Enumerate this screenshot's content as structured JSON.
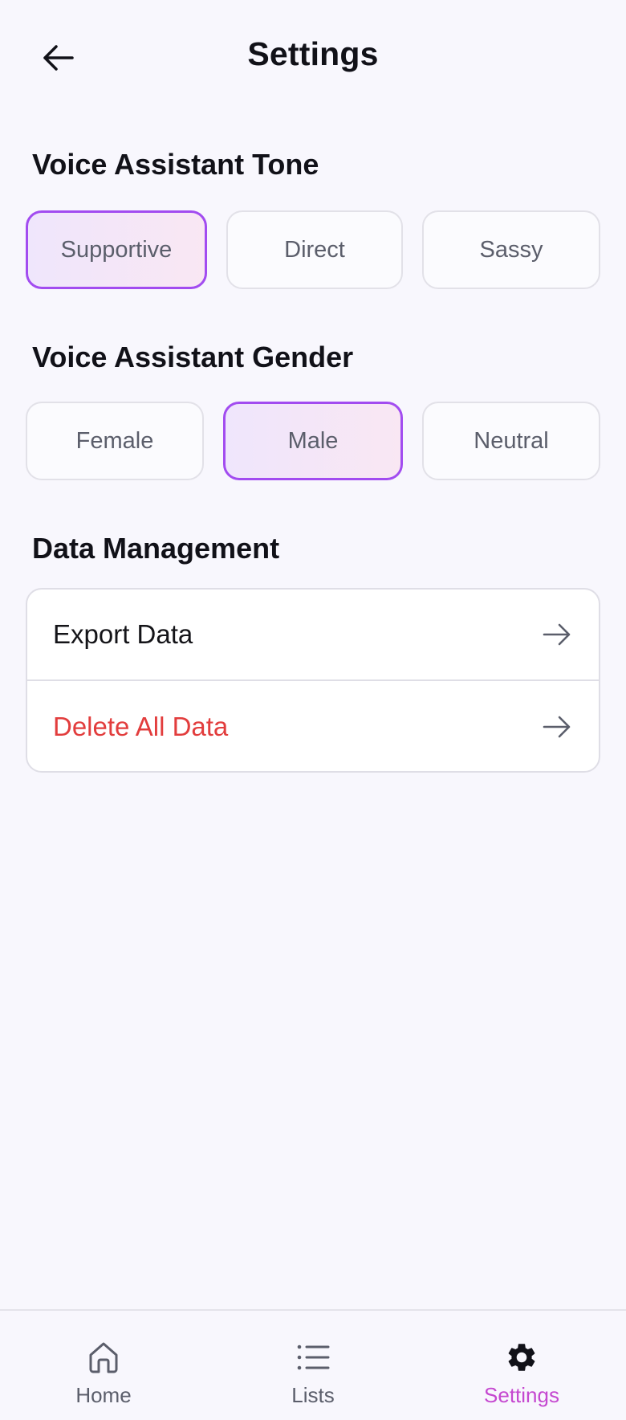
{
  "header": {
    "title": "Settings",
    "back_icon": "arrow-left-icon"
  },
  "tone": {
    "title": "Voice Assistant Tone",
    "options": [
      "Supportive",
      "Direct",
      "Sassy"
    ],
    "selected": "Supportive"
  },
  "gender": {
    "title": "Voice Assistant Gender",
    "options": [
      "Female",
      "Male",
      "Neutral"
    ],
    "selected": "Male"
  },
  "data_management": {
    "title": "Data Management",
    "items": [
      {
        "label": "Export Data",
        "icon": "arrow-right-icon"
      },
      {
        "label": "Delete All Data",
        "icon": "arrow-right-icon",
        "danger": true
      }
    ]
  },
  "bottom_nav": {
    "items": [
      {
        "label": "Home",
        "icon": "home-icon"
      },
      {
        "label": "Lists",
        "icon": "list-icon"
      },
      {
        "label": "Settings",
        "icon": "gear-icon"
      }
    ],
    "active": "Settings"
  },
  "colors": {
    "accent": "#a24cf0",
    "active_nav": "#c548d0",
    "danger": "#e23d3d",
    "background": "#f8f7fd"
  }
}
